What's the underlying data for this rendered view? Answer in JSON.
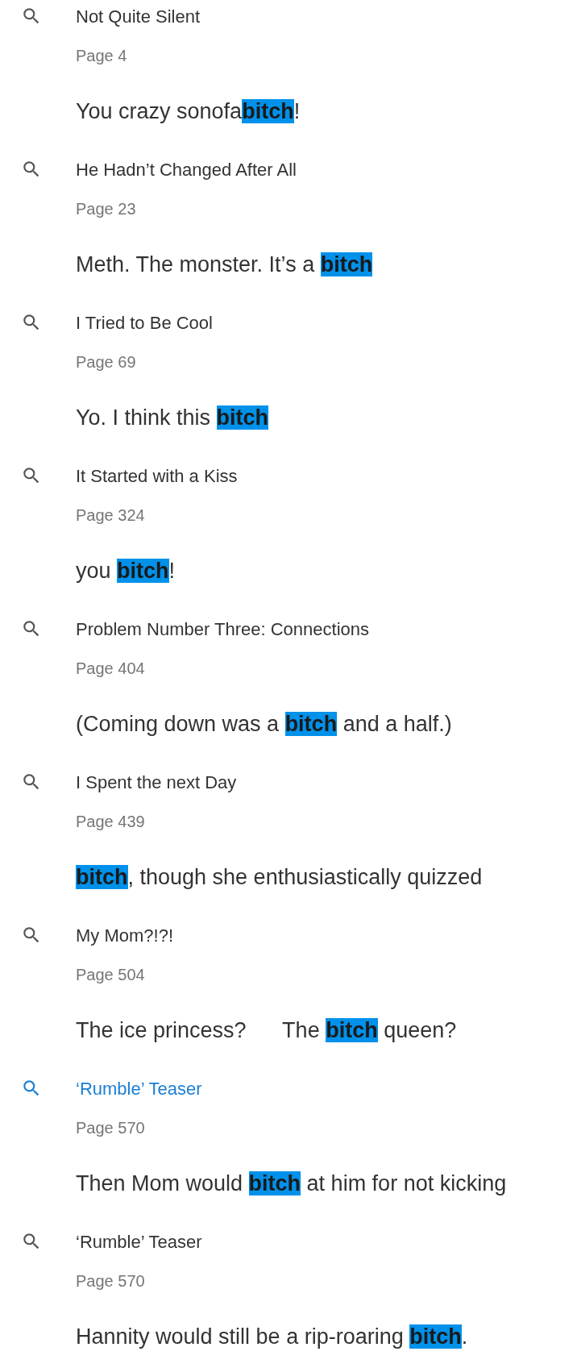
{
  "results": [
    {
      "title": "Not Quite Silent",
      "page": "Page 4",
      "snippet": "You crazy sonofa**bitch**!",
      "selected": false
    },
    {
      "title": "He Hadn’t Changed After All",
      "page": "Page 23",
      "snippet": "Meth. The monster. It’s a **bitch**",
      "selected": false
    },
    {
      "title": "I Tried to Be Cool",
      "page": "Page 69",
      "snippet": "Yo. I think this **bitch**",
      "selected": false
    },
    {
      "title": "It Started with a Kiss",
      "page": "Page 324",
      "snippet": "you **bitch**!",
      "selected": false
    },
    {
      "title": "Problem Number Three: Connections",
      "page": "Page 404",
      "snippet": "(Coming down was a **bitch** and a half.)",
      "selected": false
    },
    {
      "title": "I Spent the next Day",
      "page": "Page 439",
      "snippet": "**bitch**, though she enthusiastically quizzed",
      "selected": false
    },
    {
      "title": "My Mom?!?!",
      "page": "Page 504",
      "snippet": "The ice princess?      The **bitch** queen?",
      "selected": false
    },
    {
      "title": "‘Rumble’ Teaser",
      "page": "Page 570",
      "snippet": "Then Mom would **bitch** at him for not kicking",
      "selected": true
    },
    {
      "title": "‘Rumble’ Teaser",
      "page": "Page 570",
      "snippet": "Hannity would still be a rip-roaring **bitch**.",
      "selected": false
    }
  ]
}
